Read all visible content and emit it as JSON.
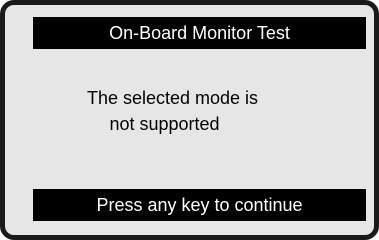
{
  "screen": {
    "title": "On-Board Monitor Test",
    "message_lines": [
      "The selected mode is",
      "not supported"
    ],
    "prompt": "Press any key to continue"
  },
  "colors": {
    "screen_background": "#e6e6e6",
    "bar_background": "#000000",
    "bar_text": "#ffffff",
    "body_text": "#000000",
    "frame": "#1a1a1a"
  }
}
